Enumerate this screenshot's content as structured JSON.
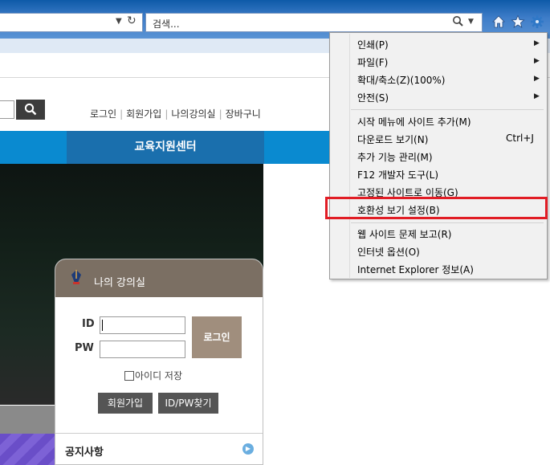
{
  "browser": {
    "search_placeholder": "검색...",
    "icons": [
      "home-icon",
      "favorites-star-icon",
      "tools-gear-icon"
    ]
  },
  "site": {
    "top_links": [
      "로그인",
      "회원가입",
      "나의강의실",
      "장바구니"
    ],
    "nav_active": "교육지원센터"
  },
  "login": {
    "title": "나의 강의실",
    "id_label": "ID",
    "pw_label": "PW",
    "login_button": "로그인",
    "save_id": "아이디 저장",
    "join_button": "회원가입",
    "find_button": "ID/PW찾기"
  },
  "notice": {
    "title": "공지사항"
  },
  "menu": {
    "items": [
      {
        "label": "인쇄(P)",
        "submenu": true
      },
      {
        "label": "파일(F)",
        "submenu": true
      },
      {
        "label": "확대/축소(Z)(100%)",
        "submenu": true
      },
      {
        "label": "안전(S)",
        "submenu": true
      },
      {
        "label": "시작 메뉴에 사이트 추가(M)"
      },
      {
        "label": "다운로드 보기(N)",
        "shortcut": "Ctrl+J"
      },
      {
        "label": "추가 기능 관리(M)"
      },
      {
        "label": "F12 개발자 도구(L)"
      },
      {
        "label": "고정된 사이트로 이동(G)"
      },
      {
        "label": "호환성 보기 설정(B)",
        "highlighted": true
      },
      {
        "label": "웹 사이트 문제 보고(R)"
      },
      {
        "label": "인터넷 옵션(O)"
      },
      {
        "label": "Internet Explorer 정보(A)"
      }
    ],
    "highlight_color": "#e11d25"
  }
}
